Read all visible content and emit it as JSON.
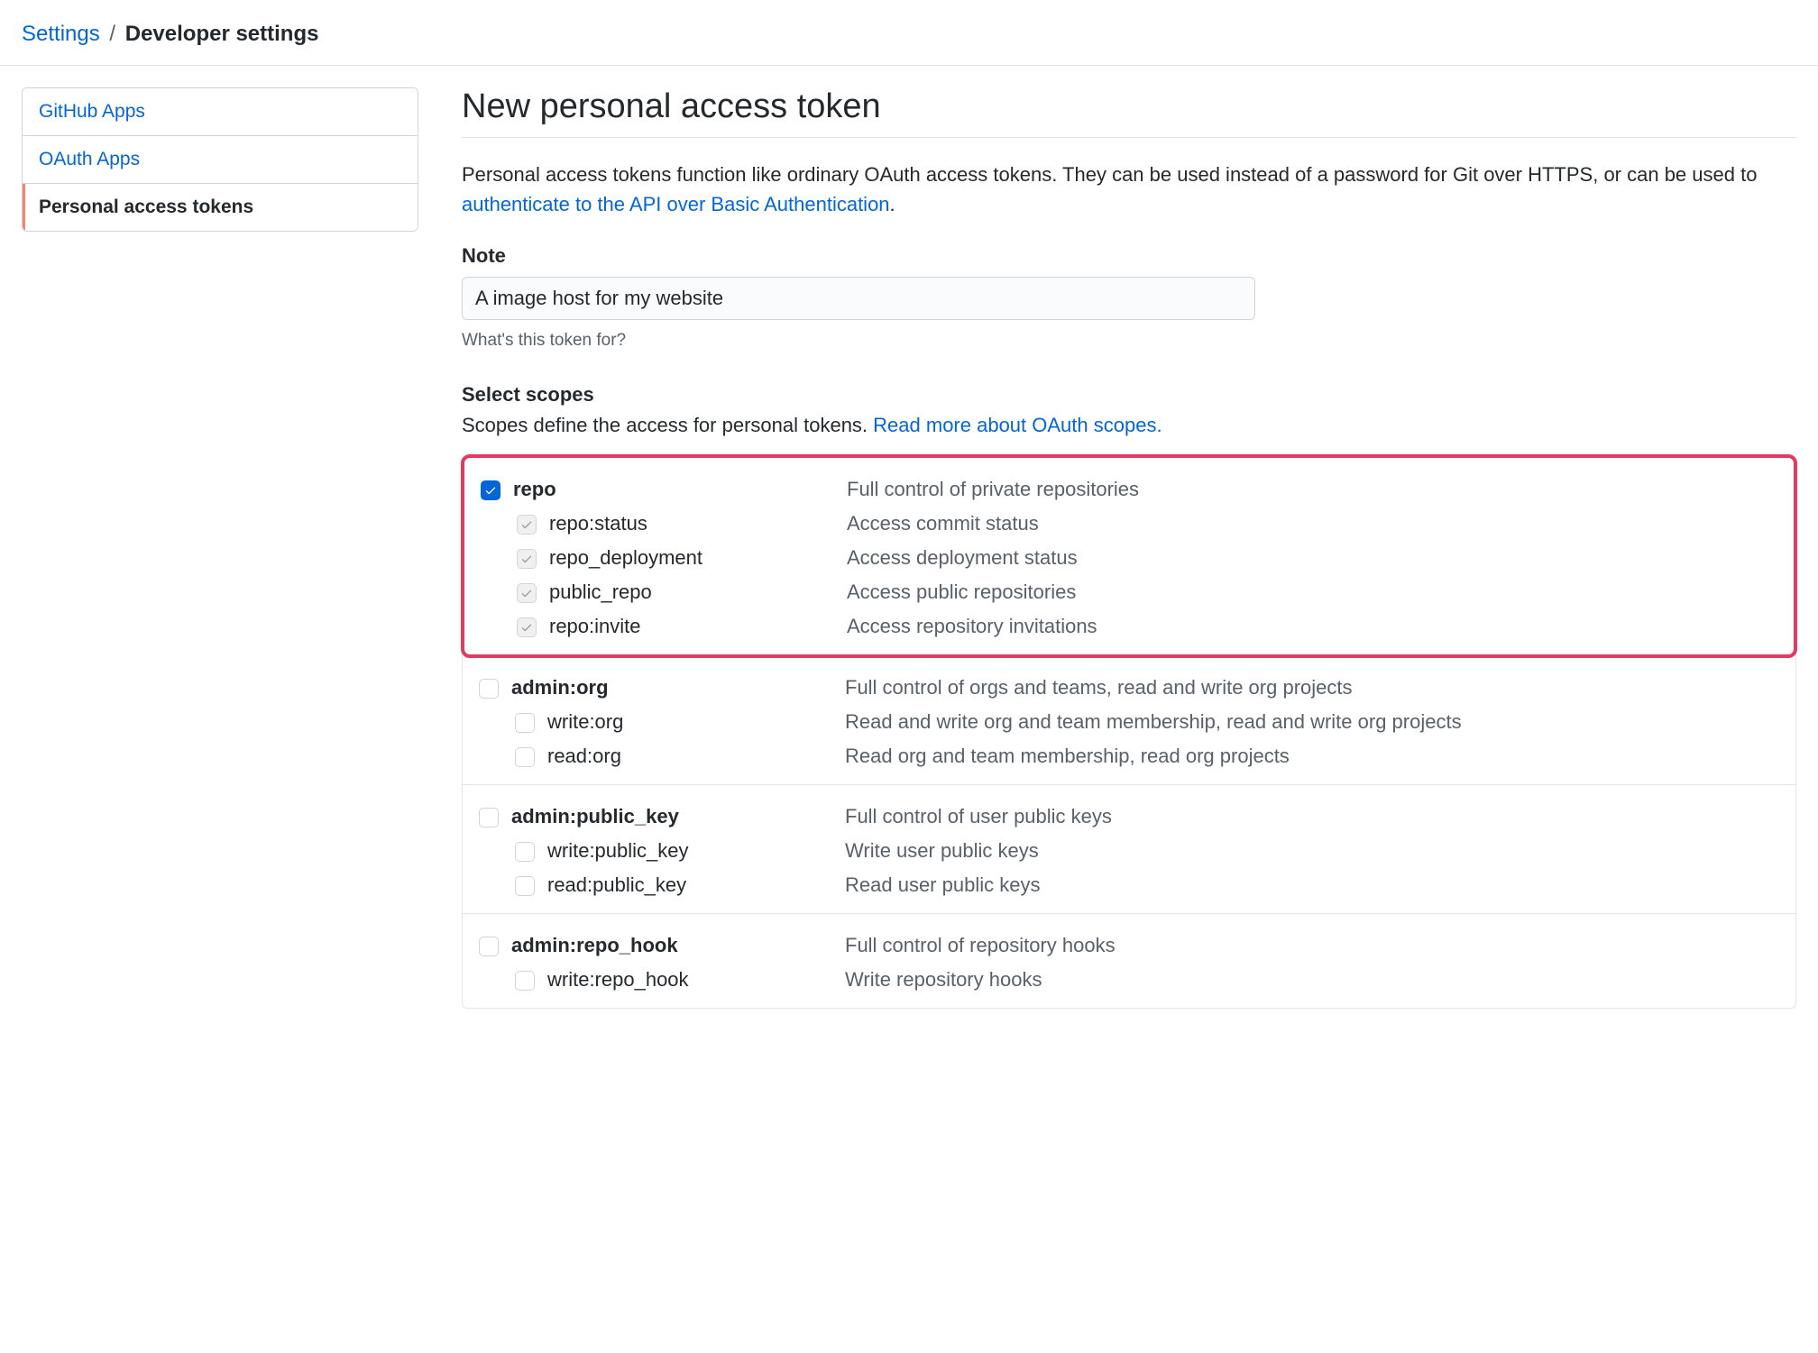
{
  "breadcrumb": {
    "parent": "Settings",
    "current": "Developer settings"
  },
  "sidebar": {
    "items": [
      {
        "label": "GitHub Apps",
        "selected": false
      },
      {
        "label": "OAuth Apps",
        "selected": false
      },
      {
        "label": "Personal access tokens",
        "selected": true
      }
    ]
  },
  "page": {
    "title": "New personal access token",
    "intro_prefix": "Personal access tokens function like ordinary OAuth access tokens. They can be used instead of a password for Git over HTTPS, or can be used to ",
    "intro_link": "authenticate to the API over Basic Authentication",
    "intro_suffix": "."
  },
  "note_field": {
    "label": "Note",
    "value": "A image host for my website",
    "hint": "What's this token for?"
  },
  "scopes_section": {
    "heading": "Select scopes",
    "intro_prefix": "Scopes define the access for personal tokens. ",
    "intro_link": "Read more about OAuth scopes.",
    "groups": [
      {
        "highlighted": true,
        "parent": {
          "name": "repo",
          "desc": "Full control of private repositories",
          "checked": true,
          "disabled": false
        },
        "children": [
          {
            "name": "repo:status",
            "desc": "Access commit status",
            "checked": true,
            "disabled": true
          },
          {
            "name": "repo_deployment",
            "desc": "Access deployment status",
            "checked": true,
            "disabled": true
          },
          {
            "name": "public_repo",
            "desc": "Access public repositories",
            "checked": true,
            "disabled": true
          },
          {
            "name": "repo:invite",
            "desc": "Access repository invitations",
            "checked": true,
            "disabled": true
          }
        ]
      },
      {
        "highlighted": false,
        "parent": {
          "name": "admin:org",
          "desc": "Full control of orgs and teams, read and write org projects",
          "checked": false,
          "disabled": false
        },
        "children": [
          {
            "name": "write:org",
            "desc": "Read and write org and team membership, read and write org projects",
            "checked": false,
            "disabled": false
          },
          {
            "name": "read:org",
            "desc": "Read org and team membership, read org projects",
            "checked": false,
            "disabled": false
          }
        ]
      },
      {
        "highlighted": false,
        "parent": {
          "name": "admin:public_key",
          "desc": "Full control of user public keys",
          "checked": false,
          "disabled": false
        },
        "children": [
          {
            "name": "write:public_key",
            "desc": "Write user public keys",
            "checked": false,
            "disabled": false
          },
          {
            "name": "read:public_key",
            "desc": "Read user public keys",
            "checked": false,
            "disabled": false
          }
        ]
      },
      {
        "highlighted": false,
        "parent": {
          "name": "admin:repo_hook",
          "desc": "Full control of repository hooks",
          "checked": false,
          "disabled": false
        },
        "children": [
          {
            "name": "write:repo_hook",
            "desc": "Write repository hooks",
            "checked": false,
            "disabled": false
          }
        ]
      }
    ]
  }
}
